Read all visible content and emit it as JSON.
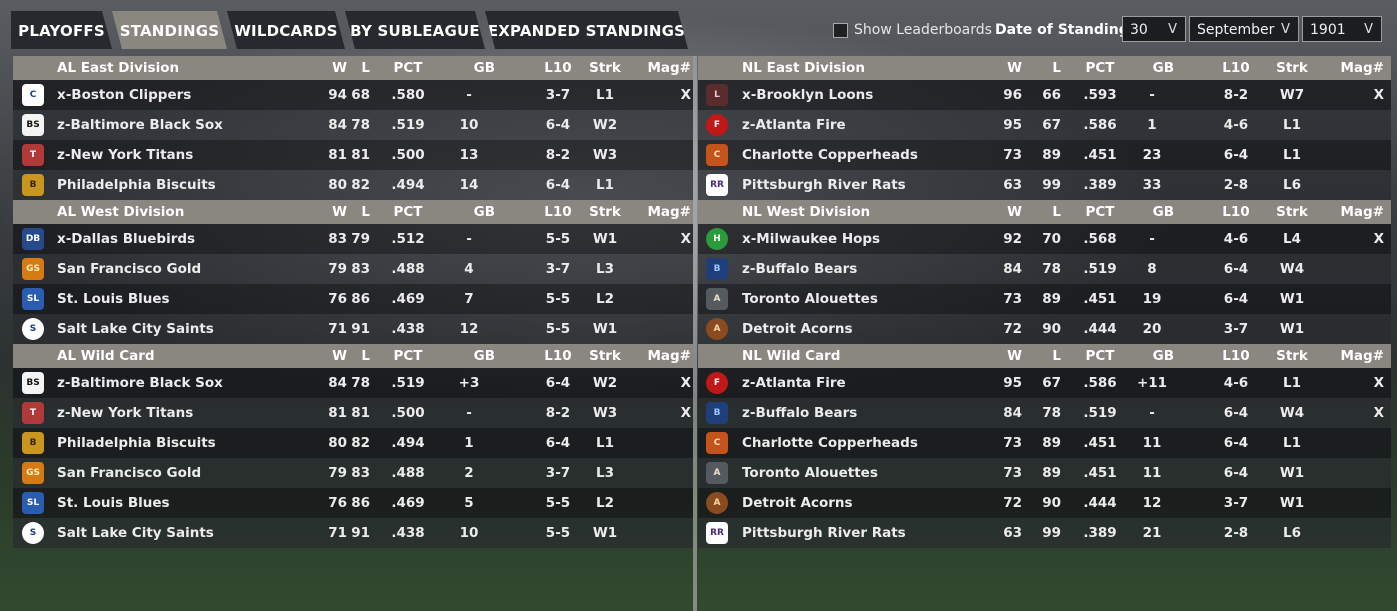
{
  "tabs": [
    {
      "label": "PLAYOFFS",
      "active": false
    },
    {
      "label": "STANDINGS",
      "active": true
    },
    {
      "label": "WILDCARDS",
      "active": false
    },
    {
      "label": "BY SUBLEAGUE",
      "active": false
    },
    {
      "label": "EXPANDED STANDINGS",
      "active": false
    }
  ],
  "controls": {
    "show_leaderboards_label": "Show Leaderboards",
    "show_leaderboards_checked": false,
    "date_label": "Date of Standings:",
    "day": "30",
    "month": "September",
    "year": "1901",
    "chevron": "V"
  },
  "columns": [
    "W",
    "L",
    "PCT",
    "GB",
    "L10",
    "Strk",
    "Mag#"
  ],
  "panels": {
    "left": [
      {
        "title": "AL East Division",
        "teams": [
          {
            "name": "x-Boston Clippers",
            "w": "94",
            "l": "68",
            "pct": ".580",
            "gb": "-",
            "l10": "3-7",
            "strk": "L1",
            "mag": "X",
            "logo": "clippers-logo"
          },
          {
            "name": "z-Baltimore Black Sox",
            "w": "84",
            "l": "78",
            "pct": ".519",
            "gb": "10",
            "l10": "6-4",
            "strk": "W2",
            "mag": "",
            "logo": "black-sox-logo"
          },
          {
            "name": "z-New York Titans",
            "w": "81",
            "l": "81",
            "pct": ".500",
            "gb": "13",
            "l10": "8-2",
            "strk": "W3",
            "mag": "",
            "logo": "titans-logo"
          },
          {
            "name": "Philadelphia Biscuits",
            "w": "80",
            "l": "82",
            "pct": ".494",
            "gb": "14",
            "l10": "6-4",
            "strk": "L1",
            "mag": "",
            "logo": "biscuits-logo"
          }
        ]
      },
      {
        "title": "AL West Division",
        "teams": [
          {
            "name": "x-Dallas Bluebirds",
            "w": "83",
            "l": "79",
            "pct": ".512",
            "gb": "-",
            "l10": "5-5",
            "strk": "W1",
            "mag": "X",
            "logo": "bluebirds-logo"
          },
          {
            "name": "San Francisco Gold",
            "w": "79",
            "l": "83",
            "pct": ".488",
            "gb": "4",
            "l10": "3-7",
            "strk": "L3",
            "mag": "",
            "logo": "gold-sox-logo"
          },
          {
            "name": "St. Louis Blues",
            "w": "76",
            "l": "86",
            "pct": ".469",
            "gb": "7",
            "l10": "5-5",
            "strk": "L2",
            "mag": "",
            "logo": "blues-logo"
          },
          {
            "name": "Salt Lake City Saints",
            "w": "71",
            "l": "91",
            "pct": ".438",
            "gb": "12",
            "l10": "5-5",
            "strk": "W1",
            "mag": "",
            "logo": "saints-logo"
          }
        ]
      },
      {
        "title": "AL  Wild Card",
        "teams": [
          {
            "name": "z-Baltimore Black Sox",
            "w": "84",
            "l": "78",
            "pct": ".519",
            "gb": "+3",
            "l10": "6-4",
            "strk": "W2",
            "mag": "X",
            "logo": "black-sox-logo"
          },
          {
            "name": "z-New York Titans",
            "w": "81",
            "l": "81",
            "pct": ".500",
            "gb": "-",
            "l10": "8-2",
            "strk": "W3",
            "mag": "X",
            "logo": "titans-logo"
          },
          {
            "name": "Philadelphia Biscuits",
            "w": "80",
            "l": "82",
            "pct": ".494",
            "gb": "1",
            "l10": "6-4",
            "strk": "L1",
            "mag": "",
            "logo": "biscuits-logo"
          },
          {
            "name": "San Francisco Gold",
            "w": "79",
            "l": "83",
            "pct": ".488",
            "gb": "2",
            "l10": "3-7",
            "strk": "L3",
            "mag": "",
            "logo": "gold-sox-logo"
          },
          {
            "name": "St. Louis Blues",
            "w": "76",
            "l": "86",
            "pct": ".469",
            "gb": "5",
            "l10": "5-5",
            "strk": "L2",
            "mag": "",
            "logo": "blues-logo"
          },
          {
            "name": "Salt Lake City Saints",
            "w": "71",
            "l": "91",
            "pct": ".438",
            "gb": "10",
            "l10": "5-5",
            "strk": "W1",
            "mag": "",
            "logo": "saints-logo"
          }
        ]
      }
    ],
    "right": [
      {
        "title": "NL East Division",
        "teams": [
          {
            "name": "x-Brooklyn Loons",
            "w": "96",
            "l": "66",
            "pct": ".593",
            "gb": "-",
            "l10": "8-2",
            "strk": "W7",
            "mag": "X",
            "logo": "loons-logo"
          },
          {
            "name": "z-Atlanta Fire",
            "w": "95",
            "l": "67",
            "pct": ".586",
            "gb": "1",
            "l10": "4-6",
            "strk": "L1",
            "mag": "",
            "logo": "fire-logo"
          },
          {
            "name": "Charlotte Copperheads",
            "w": "73",
            "l": "89",
            "pct": ".451",
            "gb": "23",
            "l10": "6-4",
            "strk": "L1",
            "mag": "",
            "logo": "copperheads-logo"
          },
          {
            "name": "Pittsburgh River Rats",
            "w": "63",
            "l": "99",
            "pct": ".389",
            "gb": "33",
            "l10": "2-8",
            "strk": "L6",
            "mag": "",
            "logo": "river-rats-logo"
          }
        ]
      },
      {
        "title": "NL West Division",
        "teams": [
          {
            "name": "x-Milwaukee Hops",
            "w": "92",
            "l": "70",
            "pct": ".568",
            "gb": "-",
            "l10": "4-6",
            "strk": "L4",
            "mag": "X",
            "logo": "hops-logo"
          },
          {
            "name": "z-Buffalo Bears",
            "w": "84",
            "l": "78",
            "pct": ".519",
            "gb": "8",
            "l10": "6-4",
            "strk": "W4",
            "mag": "",
            "logo": "bears-logo"
          },
          {
            "name": "Toronto  Alouettes",
            "w": "73",
            "l": "89",
            "pct": ".451",
            "gb": "19",
            "l10": "6-4",
            "strk": "W1",
            "mag": "",
            "logo": "alouettes-logo"
          },
          {
            "name": "Detroit Acorns",
            "w": "72",
            "l": "90",
            "pct": ".444",
            "gb": "20",
            "l10": "3-7",
            "strk": "W1",
            "mag": "",
            "logo": "acorns-logo"
          }
        ]
      },
      {
        "title": "NL  Wild Card",
        "teams": [
          {
            "name": "z-Atlanta Fire",
            "w": "95",
            "l": "67",
            "pct": ".586",
            "gb": "+11",
            "l10": "4-6",
            "strk": "L1",
            "mag": "X",
            "logo": "fire-logo"
          },
          {
            "name": "z-Buffalo Bears",
            "w": "84",
            "l": "78",
            "pct": ".519",
            "gb": "-",
            "l10": "6-4",
            "strk": "W4",
            "mag": "X",
            "logo": "bears-logo"
          },
          {
            "name": "Charlotte Copperheads",
            "w": "73",
            "l": "89",
            "pct": ".451",
            "gb": "11",
            "l10": "6-4",
            "strk": "L1",
            "mag": "",
            "logo": "copperheads-logo"
          },
          {
            "name": "Toronto  Alouettes",
            "w": "73",
            "l": "89",
            "pct": ".451",
            "gb": "11",
            "l10": "6-4",
            "strk": "W1",
            "mag": "",
            "logo": "alouettes-logo"
          },
          {
            "name": "Detroit Acorns",
            "w": "72",
            "l": "90",
            "pct": ".444",
            "gb": "12",
            "l10": "3-7",
            "strk": "W1",
            "mag": "",
            "logo": "acorns-logo"
          },
          {
            "name": "Pittsburgh River Rats",
            "w": "63",
            "l": "99",
            "pct": ".389",
            "gb": "21",
            "l10": "2-8",
            "strk": "L6",
            "mag": "",
            "logo": "river-rats-logo"
          }
        ]
      }
    ]
  },
  "logo_styles": {
    "clippers-logo": {
      "text": "C",
      "bg": "#ffffff",
      "fg": "#1b3e8c",
      "round": false
    },
    "black-sox-logo": {
      "text": "BS",
      "bg": "#f4f4f4",
      "fg": "#111111",
      "round": false
    },
    "titans-logo": {
      "text": "T",
      "bg": "#b03a3a",
      "fg": "#ffffff",
      "round": false
    },
    "biscuits-logo": {
      "text": "B",
      "bg": "#c9961f",
      "fg": "#3a2406",
      "round": false
    },
    "bluebirds-logo": {
      "text": "DB",
      "bg": "#274a8c",
      "fg": "#ffffff",
      "round": false
    },
    "gold-sox-logo": {
      "text": "GS",
      "bg": "#d77a14",
      "fg": "#fff2c0",
      "round": false
    },
    "blues-logo": {
      "text": "SL",
      "bg": "#2a5cb0",
      "fg": "#ffffff",
      "round": false
    },
    "saints-logo": {
      "text": "S",
      "bg": "#ffffff",
      "fg": "#1a3a80",
      "round": true
    },
    "loons-logo": {
      "text": "L",
      "bg": "#5b2c2c",
      "fg": "#f0c8c8",
      "round": false
    },
    "fire-logo": {
      "text": "F",
      "bg": "#c01818",
      "fg": "#ffffff",
      "round": true
    },
    "copperheads-logo": {
      "text": "C",
      "bg": "#c4531c",
      "fg": "#ffe0c0",
      "round": false
    },
    "river-rats-logo": {
      "text": "RR",
      "bg": "#ffffff",
      "fg": "#4a2a7a",
      "round": false
    },
    "hops-logo": {
      "text": "H",
      "bg": "#2a9a3c",
      "fg": "#ffffff",
      "round": true
    },
    "bears-logo": {
      "text": "B",
      "bg": "#1f3f7a",
      "fg": "#9cc7ff",
      "round": false
    },
    "alouettes-logo": {
      "text": "A",
      "bg": "#555a5e",
      "fg": "#e8e0c8",
      "round": false
    },
    "acorns-logo": {
      "text": "A",
      "bg": "#8a4b1e",
      "fg": "#f5d9a8",
      "round": true
    }
  },
  "colors": {
    "header_bg": "#8a8781",
    "active_tab_bg": "#8a8781",
    "tab_bg": "#26292d"
  }
}
